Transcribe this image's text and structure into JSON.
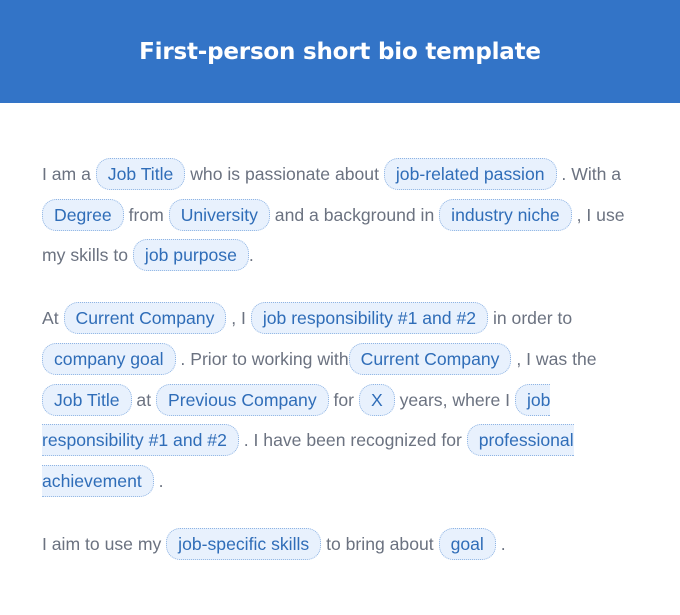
{
  "header": {
    "title": "First-person short bio template"
  },
  "paragraphs": [
    {
      "segments": [
        {
          "type": "text",
          "value": "I am a "
        },
        {
          "type": "placeholder",
          "value": "Job Title"
        },
        {
          "type": "text",
          "value": " who is passionate about "
        },
        {
          "type": "placeholder",
          "value": "job-related passion"
        },
        {
          "type": "text",
          "value": " . With a "
        },
        {
          "type": "placeholder",
          "value": "Degree"
        },
        {
          "type": "text",
          "value": " from "
        },
        {
          "type": "placeholder",
          "value": "University"
        },
        {
          "type": "text",
          "value": " and a background in "
        },
        {
          "type": "placeholder",
          "value": "industry niche"
        },
        {
          "type": "text",
          "value": " , I use my skills to "
        },
        {
          "type": "placeholder",
          "value": "job purpose"
        },
        {
          "type": "text",
          "value": "."
        }
      ]
    },
    {
      "segments": [
        {
          "type": "text",
          "value": "At "
        },
        {
          "type": "placeholder",
          "value": "Current Company"
        },
        {
          "type": "text",
          "value": " , I "
        },
        {
          "type": "placeholder",
          "value": "job responsibility #1 and #2"
        },
        {
          "type": "text",
          "value": " in order to "
        },
        {
          "type": "placeholder",
          "value": "company goal"
        },
        {
          "type": "text",
          "value": " . Prior to working with"
        },
        {
          "type": "placeholder",
          "value": "Current Company"
        },
        {
          "type": "text",
          "value": " , I was the "
        },
        {
          "type": "placeholder",
          "value": "Job Title"
        },
        {
          "type": "text",
          "value": " at "
        },
        {
          "type": "placeholder",
          "value": "Previous Company"
        },
        {
          "type": "text",
          "value": " for "
        },
        {
          "type": "placeholder",
          "value": "X"
        },
        {
          "type": "text",
          "value": " years, where I "
        },
        {
          "type": "placeholder",
          "value": "job responsibility #1 and #2"
        },
        {
          "type": "text",
          "value": " . I have been recognized for "
        },
        {
          "type": "placeholder",
          "value": "professional achievement"
        },
        {
          "type": "text",
          "value": " ."
        }
      ]
    },
    {
      "segments": [
        {
          "type": "text",
          "value": "I aim to use my "
        },
        {
          "type": "placeholder",
          "value": "job-specific skills"
        },
        {
          "type": "text",
          "value": " to bring about "
        },
        {
          "type": "placeholder",
          "value": "goal"
        },
        {
          "type": "text",
          "value": " ."
        }
      ]
    }
  ],
  "colors": {
    "header_bg": "#3374c7",
    "body_text": "#6b7280",
    "placeholder_text": "#2f6db8",
    "placeholder_bg": "#e8f1fd",
    "placeholder_border": "#8fb4e3"
  }
}
